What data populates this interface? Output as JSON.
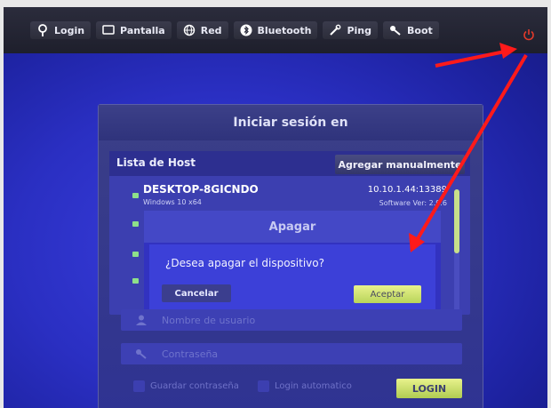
{
  "toolbar": {
    "items": [
      {
        "label": "Login",
        "icon": "login-key-icon"
      },
      {
        "label": "Pantalla",
        "icon": "monitor-icon"
      },
      {
        "label": "Red",
        "icon": "globe-icon"
      },
      {
        "label": "Bluetooth",
        "icon": "bluetooth-icon"
      },
      {
        "label": "Ping",
        "icon": "wrench-icon"
      },
      {
        "label": "Boot",
        "icon": "key-icon"
      }
    ],
    "power_icon": "power-icon",
    "power_color": "#e23a2a"
  },
  "login_panel": {
    "title": "Iniciar sesión en",
    "host_list_label": "Lista de Host",
    "add_manual_label": "Agregar manualmente",
    "host": {
      "name": "DESKTOP-8GICNDO",
      "os": "Windows 10 x64",
      "address": "10.10.1.44:13389",
      "software": "Software Ver: 2.9.6"
    },
    "username_placeholder": "Nombre de usuario",
    "password_placeholder": "Contraseña",
    "save_password_label": "Guardar contraseña",
    "auto_login_label": "Login automatico",
    "login_button": "LOGIN"
  },
  "dialog": {
    "title": "Apagar",
    "message": "¿Desea apagar el dispositivo?",
    "cancel_label": "Cancelar",
    "accept_label": "Aceptar"
  },
  "colors": {
    "accent_green": "#c8e08a",
    "status_dot": "#8ee08a",
    "annotation_arrow": "#ff1a1a"
  }
}
